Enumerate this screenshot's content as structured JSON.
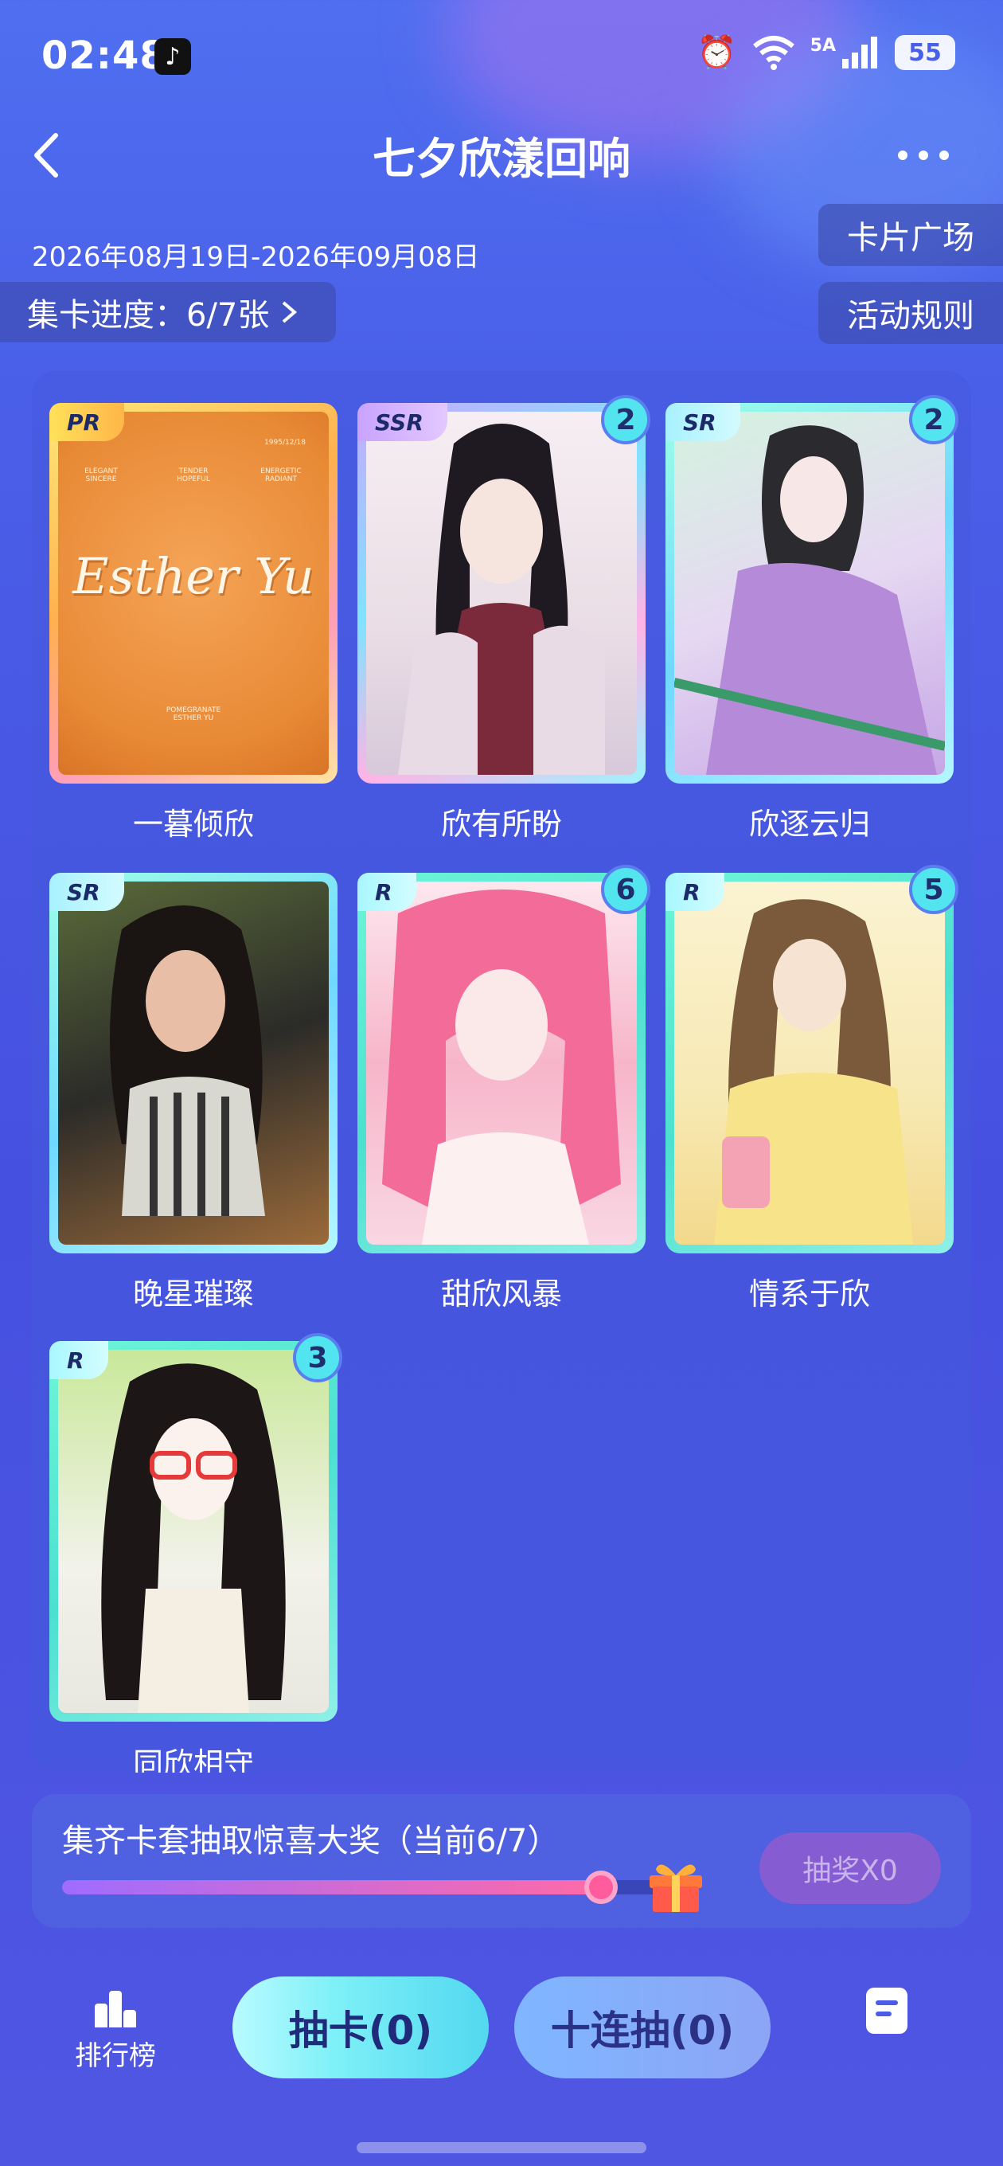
{
  "status_bar": {
    "time": "02:48",
    "network": "5A",
    "battery": "55"
  },
  "header": {
    "title": "七夕欣漾回响"
  },
  "event": {
    "date_range": "2026年08月19日-2026年09月08日",
    "progress_label": "集卡进度：6/7张",
    "plaza_button": "卡片广场",
    "rules_button": "活动规则"
  },
  "cards": [
    {
      "name": "一暮倾欣",
      "rarity": "PR",
      "count": ""
    },
    {
      "name": "欣有所盼",
      "rarity": "SSR",
      "count": "2"
    },
    {
      "name": "欣逐云归",
      "rarity": "SR",
      "count": "2"
    },
    {
      "name": "晚星璀璨",
      "rarity": "SR",
      "count": ""
    },
    {
      "name": "甜欣风暴",
      "rarity": "R",
      "count": "6"
    },
    {
      "name": "情系于欣",
      "rarity": "R",
      "count": "5"
    },
    {
      "name": "同欣相守",
      "rarity": "R",
      "count": "3"
    }
  ],
  "esther_card": {
    "script_text": "Esther Yu"
  },
  "reward": {
    "text": "集齐卡套抽取惊喜大奖（当前6/7）",
    "progress": 0.857,
    "draw_button": "抽奖X0"
  },
  "tabbar": {
    "ranking_label": "排行榜",
    "draw_one": "抽卡(0)",
    "draw_ten": "十连抽(0)"
  },
  "colors": {
    "accent_cyan": "#52e5ef",
    "background": "#4a5fe8"
  }
}
